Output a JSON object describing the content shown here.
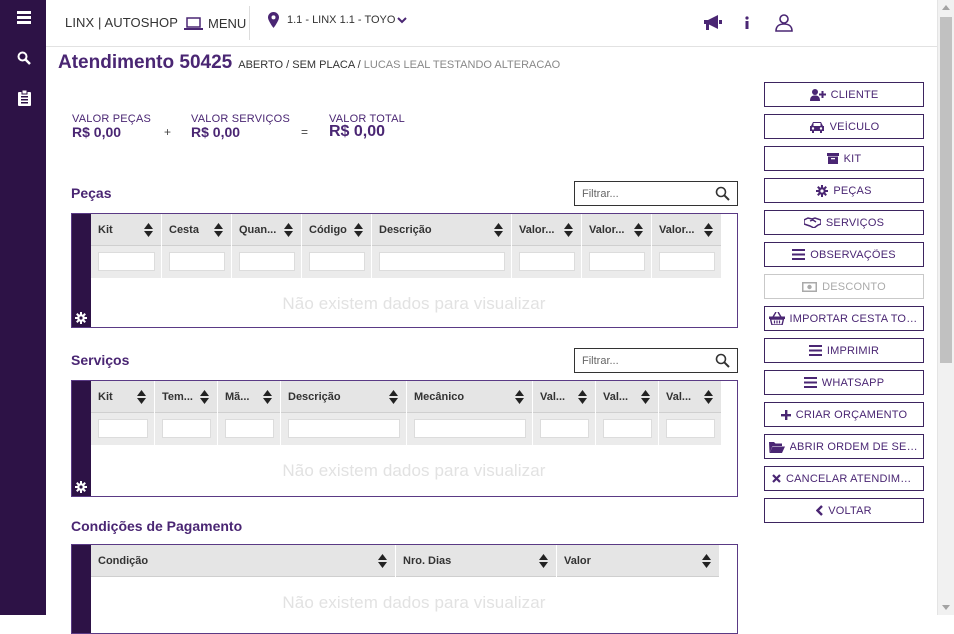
{
  "header": {
    "brand": "LINX | AUTOSHOP",
    "menu_label": "MENU",
    "location": "1.1 - LINX 1.1 - TOYO"
  },
  "title": {
    "heading": "Atendimento 50425",
    "status": "ABERTO / SEM PLACA /",
    "client": "LUCAS LEAL TESTANDO ALTERACAO"
  },
  "totals": {
    "parts_label": "VALOR PEÇAS",
    "parts_value": "R$ 0,00",
    "plus": "+",
    "services_label": "VALOR SERVIÇOS",
    "services_value": "R$ 0,00",
    "equals": "=",
    "total_label": "VALOR TOTAL",
    "total_value": "R$ 0,00"
  },
  "parts": {
    "title": "Peças",
    "filter_placeholder": "Filtrar...",
    "columns": [
      "Kit",
      "Cesta",
      "Quan...",
      "Código",
      "Descrição",
      "Valor...",
      "Valor...",
      "Valor..."
    ],
    "empty": "Não existem dados para visualizar"
  },
  "services": {
    "title": "Serviços",
    "filter_placeholder": "Filtrar...",
    "columns": [
      "Kit",
      "Tem...",
      "Mã...",
      "Descrição",
      "Mecânico",
      "Val...",
      "Val...",
      "Val..."
    ],
    "empty": "Não existem dados para visualizar"
  },
  "payment": {
    "title": "Condições de Pagamento",
    "columns": [
      "Condição",
      "Nro. Dias",
      "Valor"
    ],
    "empty": "Não existem dados para visualizar"
  },
  "actions": [
    {
      "label": "CLIENTE",
      "icon": "user-plus-icon",
      "disabled": false
    },
    {
      "label": "VEÍCULO",
      "icon": "car-icon",
      "disabled": false
    },
    {
      "label": "KIT",
      "icon": "box-icon",
      "disabled": false
    },
    {
      "label": "PEÇAS",
      "icon": "gear-icon",
      "disabled": false
    },
    {
      "label": "SERVIÇOS",
      "icon": "handshake-icon",
      "disabled": false
    },
    {
      "label": "OBSERVAÇÕES",
      "icon": "bars-icon",
      "disabled": false
    },
    {
      "label": "DESCONTO",
      "icon": "money-icon",
      "disabled": true
    },
    {
      "label": "IMPORTAR CESTA TOP...",
      "icon": "basket-icon",
      "disabled": false
    },
    {
      "label": "IMPRIMIR",
      "icon": "bars-icon",
      "disabled": false
    },
    {
      "label": "WHATSAPP",
      "icon": "bars-icon",
      "disabled": false
    },
    {
      "label": "CRIAR ORÇAMENTO",
      "icon": "plus-icon",
      "disabled": false
    },
    {
      "label": "ABRIR ORDEM DE SER...",
      "icon": "folder-open-icon",
      "disabled": false
    },
    {
      "label": "CANCELAR ATENDIME...",
      "icon": "close-icon",
      "disabled": false
    },
    {
      "label": "VOLTAR",
      "icon": "chevron-left-icon",
      "disabled": false
    }
  ],
  "colors": {
    "sidebar": "#2d1246",
    "accent": "#4a2673",
    "grid_header": "#e5e5e5"
  }
}
